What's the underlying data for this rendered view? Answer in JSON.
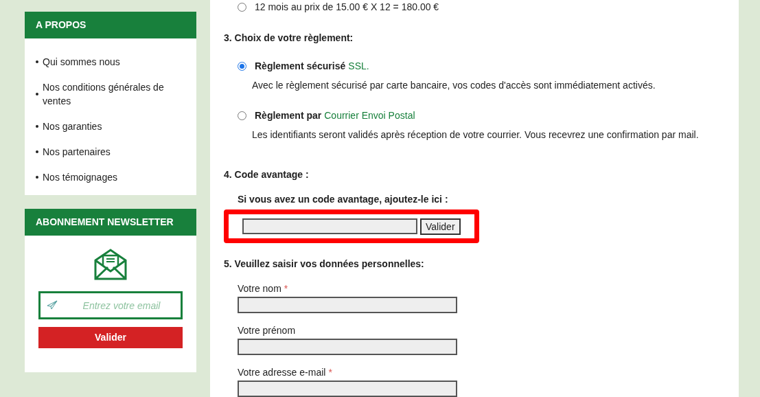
{
  "sidebar": {
    "about": {
      "title": "A PROPOS",
      "items": [
        "Qui sommes nous",
        "Nos conditions générales de ventes",
        "Nos garanties",
        "Nos partenaires",
        "Nos témoignages"
      ]
    },
    "newsletter": {
      "title": "ABONNEMENT NEWSLETTER",
      "placeholder": "Entrez votre email",
      "button": "Valider"
    }
  },
  "main": {
    "duration_option": {
      "label": "12 mois au prix de 15.00 € X 12 = 180.00 €",
      "selected": false
    },
    "payment": {
      "heading": "3. Choix de votre règlement:",
      "options": [
        {
          "title": "Règlement sécurisé",
          "link": "SSL.",
          "description": "Avec le règlement sécurisé par carte bancaire, vos codes d'accès sont immédiatement activés.",
          "selected": true
        },
        {
          "title": "Règlement par",
          "link": "Courrier Envoi Postal",
          "description": "Les identifiants seront validés après réception de votre courrier. Vous recevrez une confirmation par mail.",
          "selected": false
        }
      ]
    },
    "promo": {
      "heading": "4. Code avantage :",
      "prompt": "Si vous avez un code avantage, ajoutez-le ici :",
      "button": "Valider",
      "highlighted": true
    },
    "personal": {
      "heading": "5. Veuillez saisir vos données personnelles:",
      "fields": [
        {
          "label": "Votre nom",
          "required_mark": "*"
        },
        {
          "label": "Votre prénom"
        },
        {
          "label": "Votre adresse e-mail",
          "required_mark": "*"
        }
      ]
    }
  }
}
